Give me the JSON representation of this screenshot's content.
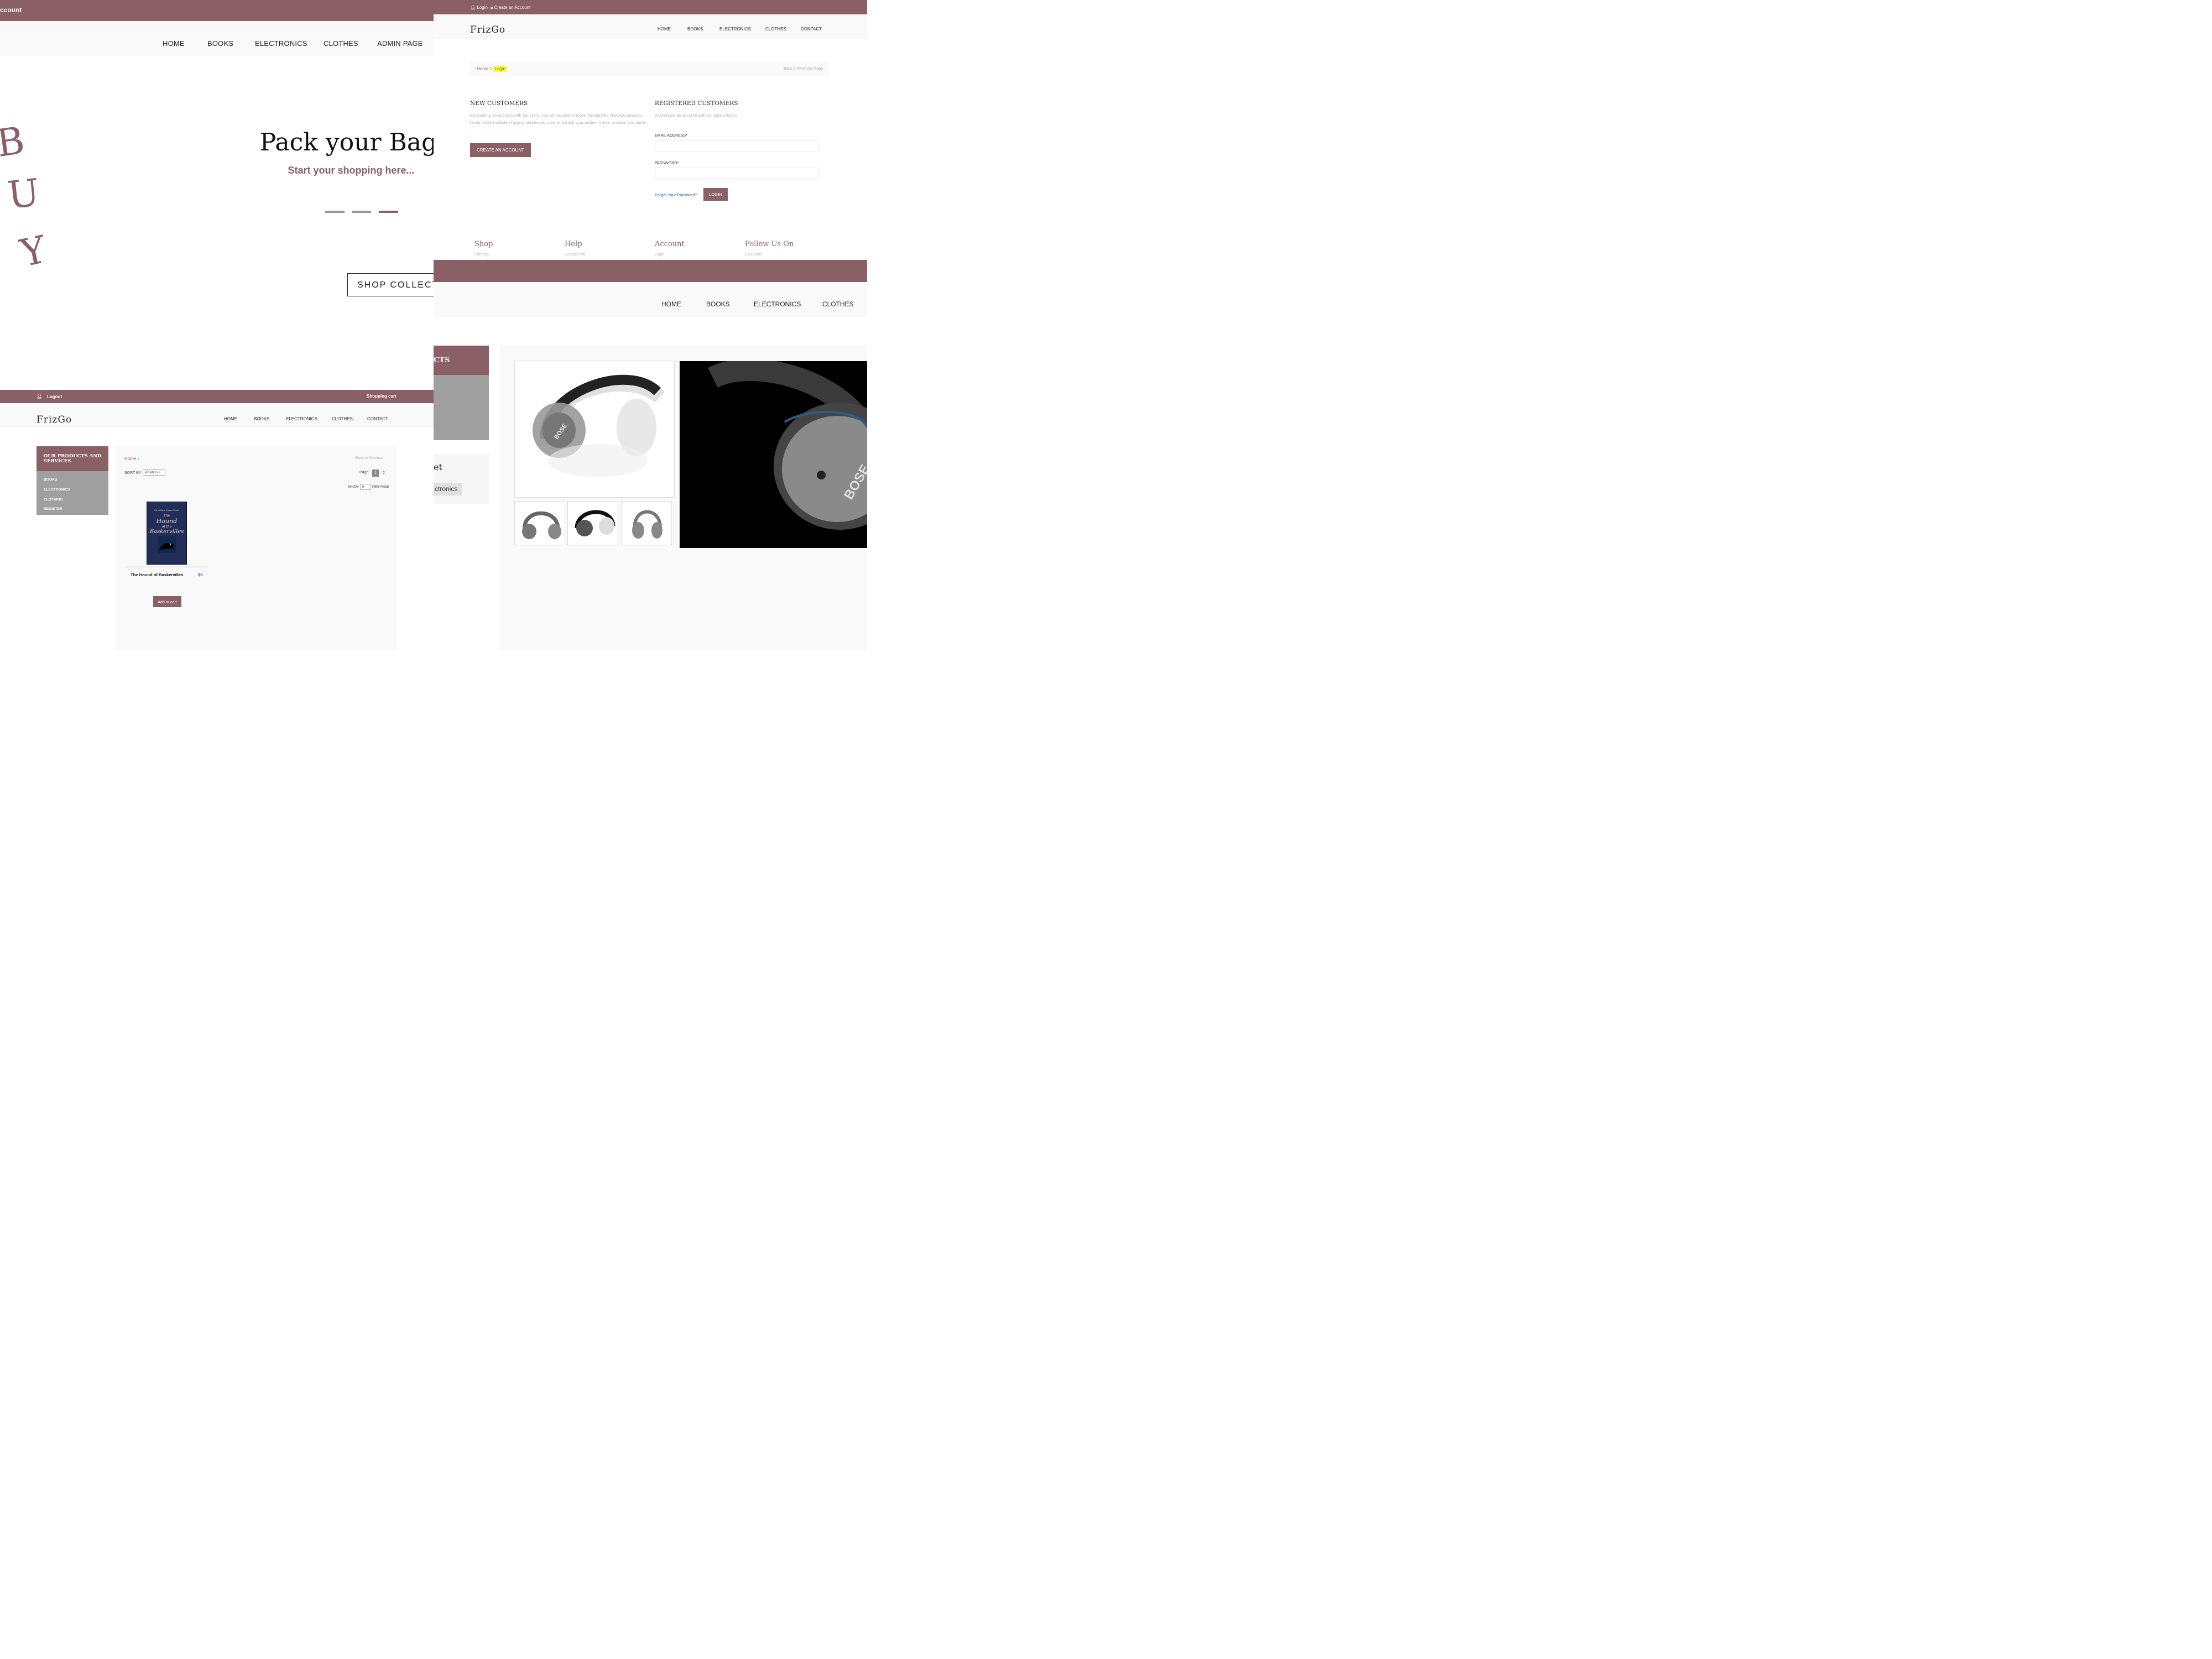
{
  "hero": {
    "account_label": "ccount",
    "nav": [
      "HOME",
      "BOOKS",
      "ELECTRONICS",
      "CLOTHES",
      "ADMIN PAGE"
    ],
    "buy_letters": [
      "B",
      "U",
      "Y"
    ],
    "headline": "Pack your Bag",
    "subtitle": "Start your shopping here...",
    "slider_active": 3,
    "shop_button": "SHOP COLLECTI"
  },
  "login": {
    "top_login": "Login",
    "top_create": "Create an Account",
    "logo": "FrizGo",
    "nav": [
      "HOME",
      "BOOKS",
      "ELECTRONICS",
      "CLOTHES",
      "CONTACT"
    ],
    "breadcrumb_home": "Home",
    "breadcrumb_sep": ">",
    "breadcrumb_current": "Login",
    "back_link": "Back to Previous Page",
    "new_customers_title": "NEW CUSTOMERS",
    "new_customers_text": "By creating an account with our store, you will be able to move through the checkout process faster, store multiple shipping addresses, view and track your orders in your account and more.",
    "create_account_button": "CREATE AN ACCOUNT",
    "registered_title": "REGISTERED CUSTOMERS",
    "registered_text": "If you have an account with us, please log in.",
    "email_label": "EMAIL ADDRESS*",
    "email_value": "",
    "password_label": "PASSWORD*",
    "password_value": "",
    "forgot_link": "Forgot Your Password?",
    "login_button": "LOGIN",
    "footer": [
      {
        "title": "Shop",
        "item": "Clothing"
      },
      {
        "title": "Help",
        "item": "Contact Info"
      },
      {
        "title": "Account",
        "item": "Login"
      },
      {
        "title": "Follow Us On",
        "item": "Facebook"
      }
    ]
  },
  "product": {
    "nav": [
      "HOME",
      "BOOKS",
      "ELECTRONICS",
      "CLOTHES"
    ],
    "sidebar_heading": "CTS",
    "box_title": "et",
    "box_chip": "ctronics",
    "brand_text": "BOSE"
  },
  "catalog": {
    "logout": "Logout",
    "cart": "Shopping cart",
    "logo": "FrizGo",
    "nav": [
      "HOME",
      "BOOKS",
      "ELECTRONICS",
      "CLOTHES",
      "CONTACT"
    ],
    "sidebar_title": "OUR PRODUCTS AND SERVICES",
    "sidebar_items": [
      "BOOKS",
      "ELECTRONICS",
      "CLOTHING",
      "REGISTER"
    ],
    "breadcrumb": "Home",
    "breadcrumb_sep": "›",
    "back_link": "Back to Previous",
    "sort_label": "SORT BY",
    "sort_value": "Position",
    "page_label": "Page:",
    "pages": [
      "1",
      "2"
    ],
    "show_label": "SHOW",
    "show_value": "9",
    "per_page_label": "PER PAGE",
    "book_cover_author": "Sir Arthur Conan Doyle",
    "book_cover_title": [
      "The",
      "Hound",
      "of the",
      "Baskervilles"
    ],
    "product_name": "The Hound of Baskervilles",
    "price": "$9",
    "add_to_cart": "Add to cart"
  },
  "colors": {
    "brand": "#8a5f66",
    "sidebar_gray": "#a09fa0",
    "highlight": "#ffff33",
    "link_blue": "#2a5a9a"
  }
}
